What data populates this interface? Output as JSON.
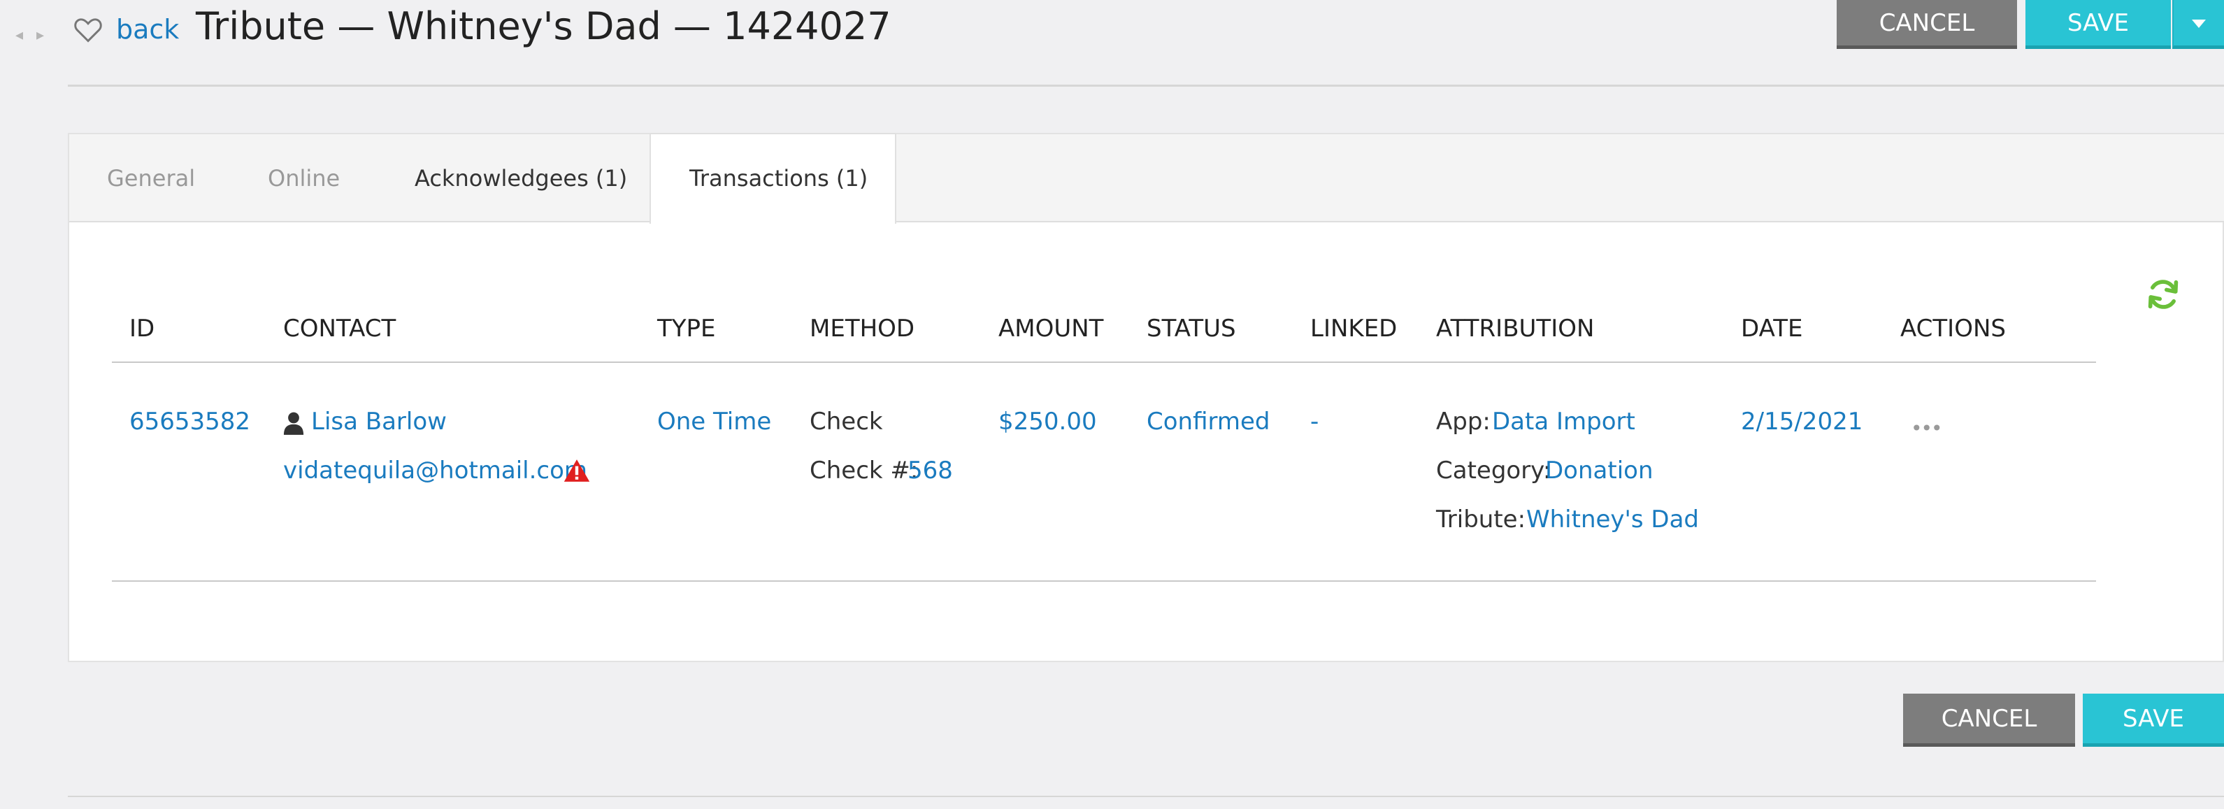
{
  "header": {
    "nav_arrows": "◂ ▸",
    "back_label": "back",
    "title": "Tribute — Whitney's Dad — 1424027",
    "cancel_label": "CANCEL",
    "save_label": "SAVE"
  },
  "tabs": [
    {
      "label": "General",
      "active": false
    },
    {
      "label": "Online",
      "active": false
    },
    {
      "label": "Acknowledgees (1)",
      "active": false
    },
    {
      "label": "Transactions (1)",
      "active": true
    }
  ],
  "table": {
    "columns": [
      "ID",
      "CONTACT",
      "TYPE",
      "METHOD",
      "AMOUNT",
      "STATUS",
      "LINKED",
      "ATTRIBUTION",
      "DATE",
      "ACTIONS"
    ],
    "rows": [
      {
        "id": "65653582",
        "contact_name": "Lisa Barlow",
        "contact_email": "vidatequila@hotmail.com",
        "type": "One Time",
        "method": "Check",
        "check_label": "Check #:",
        "check_number": "568",
        "amount": "$250.00",
        "status": "Confirmed",
        "linked": "-",
        "attribution": [
          {
            "label": "App:",
            "value": "Data Import"
          },
          {
            "label": "Category:",
            "value": "Donation"
          },
          {
            "label": "Tribute:",
            "value": "Whitney's Dad"
          }
        ],
        "date": "2/15/2021",
        "actions": "•••"
      }
    ]
  },
  "footer": {
    "cancel_label": "CANCEL",
    "save_label": "SAVE"
  },
  "colors": {
    "link": "#1a7bbf",
    "save_button": "#29c4d4",
    "cancel_button": "#7d7d7d",
    "refresh_icon": "#6abf3a",
    "warning_icon": "#e02020"
  },
  "icons": [
    "nav-arrows-icon",
    "heart-icon",
    "refresh-icon",
    "person-icon",
    "warning-icon",
    "more-actions-icon"
  ]
}
